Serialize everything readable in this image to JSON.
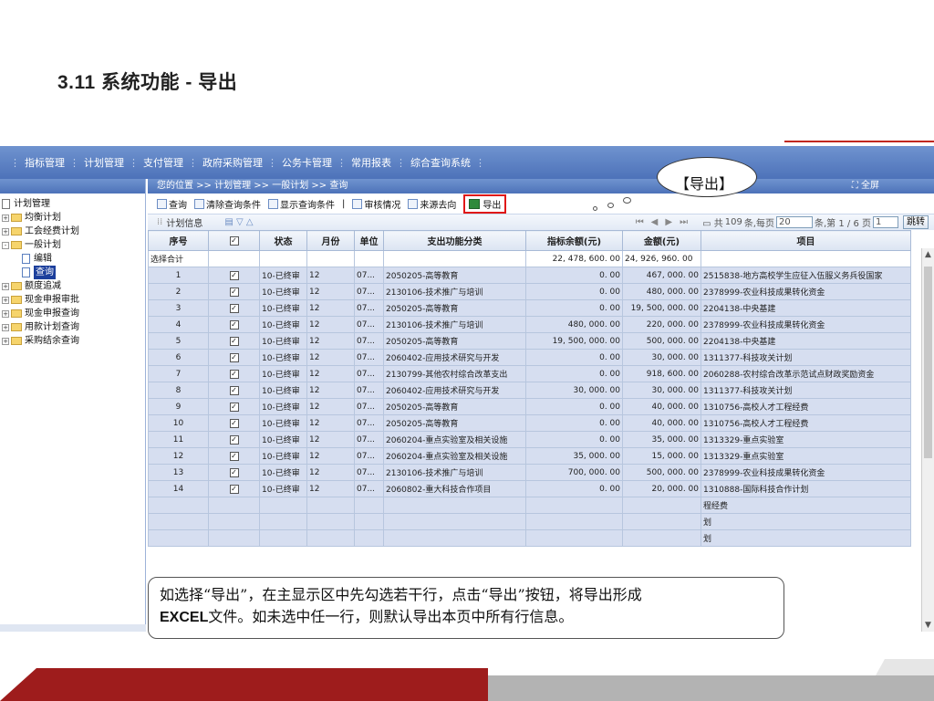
{
  "slide": {
    "title": "3.11  系统功能 - 导出"
  },
  "menubar": {
    "items": [
      "指标管理",
      "计划管理",
      "支付管理",
      "政府采购管理",
      "公务卡管理",
      "常用报表",
      "综合查询系统"
    ]
  },
  "sidebar": {
    "root": "计划管理",
    "items": [
      {
        "label": "均衡计划",
        "kind": "folder",
        "exp": "+"
      },
      {
        "label": "工会经费计划",
        "kind": "folder",
        "exp": "+"
      },
      {
        "label": "一般计划",
        "kind": "folder",
        "exp": "-"
      },
      {
        "label": "编辑",
        "kind": "doc"
      },
      {
        "label": "查询",
        "kind": "doc",
        "selected": true
      },
      {
        "label": "额度追减",
        "kind": "folder",
        "exp": "+"
      },
      {
        "label": "现金申报审批",
        "kind": "folder",
        "exp": "+"
      },
      {
        "label": "现金申报查询",
        "kind": "folder",
        "exp": "+"
      },
      {
        "label": "用款计划查询",
        "kind": "folder",
        "exp": "+"
      },
      {
        "label": "采购结余查询",
        "kind": "folder",
        "exp": "+"
      }
    ]
  },
  "breadcrumb": "您的位置 >> 计划管理 >> 一般计划 >> 查询",
  "fullscreen": "全屏",
  "toolbar": {
    "query": "查询",
    "clear": "清除查询条件",
    "show": "显示查询条件",
    "audit": "审核情况",
    "source": "来源去向",
    "export": "导出"
  },
  "grid": {
    "title": "计划信息",
    "pager": {
      "total_prefix": "共",
      "total": "109",
      "per_page_label": "条,每页",
      "per_page": "20",
      "page_label": "条,第 1 / 6 页",
      "page": "1",
      "go": "跳转"
    },
    "headers": [
      "序号",
      "",
      "状态",
      "月份",
      "单位",
      "支出功能分类",
      "指标余额(元)",
      "金额(元)",
      "项目"
    ],
    "total_row": {
      "label": "选择合计",
      "balance": "22, 478, 600. 00",
      "amount": "24, 926, 960. 00"
    },
    "rows": [
      {
        "no": "1",
        "status": "10-已终审",
        "month": "12",
        "unit": "07...",
        "cls": "2050205-高等教育",
        "bal": "0. 00",
        "amt": "467, 000. 00",
        "proj": "2515838-地方高校学生应征入伍服义务兵役国家"
      },
      {
        "no": "2",
        "status": "10-已终审",
        "month": "12",
        "unit": "07...",
        "cls": "2130106-技术推广与培训",
        "bal": "0. 00",
        "amt": "480, 000. 00",
        "proj": "2378999-农业科技成果转化资金"
      },
      {
        "no": "3",
        "status": "10-已终审",
        "month": "12",
        "unit": "07...",
        "cls": "2050205-高等教育",
        "bal": "0. 00",
        "amt": "19, 500, 000. 00",
        "proj": "2204138-中央基建"
      },
      {
        "no": "4",
        "status": "10-已终审",
        "month": "12",
        "unit": "07...",
        "cls": "2130106-技术推广与培训",
        "bal": "480, 000. 00",
        "amt": "220, 000. 00",
        "proj": "2378999-农业科技成果转化资金"
      },
      {
        "no": "5",
        "status": "10-已终审",
        "month": "12",
        "unit": "07...",
        "cls": "2050205-高等教育",
        "bal": "19, 500, 000. 00",
        "amt": "500, 000. 00",
        "proj": "2204138-中央基建"
      },
      {
        "no": "6",
        "status": "10-已终审",
        "month": "12",
        "unit": "07...",
        "cls": "2060402-应用技术研究与开发",
        "bal": "0. 00",
        "amt": "30, 000. 00",
        "proj": "1311377-科技攻关计划"
      },
      {
        "no": "7",
        "status": "10-已终审",
        "month": "12",
        "unit": "07...",
        "cls": "2130799-其他农村综合改革支出",
        "bal": "0. 00",
        "amt": "918, 600. 00",
        "proj": "2060288-农村综合改革示范试点财政奖励资金"
      },
      {
        "no": "8",
        "status": "10-已终审",
        "month": "12",
        "unit": "07...",
        "cls": "2060402-应用技术研究与开发",
        "bal": "30, 000. 00",
        "amt": "30, 000. 00",
        "proj": "1311377-科技攻关计划"
      },
      {
        "no": "9",
        "status": "10-已终审",
        "month": "12",
        "unit": "07...",
        "cls": "2050205-高等教育",
        "bal": "0. 00",
        "amt": "40, 000. 00",
        "proj": "1310756-高校人才工程经费"
      },
      {
        "no": "10",
        "status": "10-已终审",
        "month": "12",
        "unit": "07...",
        "cls": "2050205-高等教育",
        "bal": "0. 00",
        "amt": "40, 000. 00",
        "proj": "1310756-高校人才工程经费"
      },
      {
        "no": "11",
        "status": "10-已终审",
        "month": "12",
        "unit": "07...",
        "cls": "2060204-重点实验室及相关设施",
        "bal": "0. 00",
        "amt": "35, 000. 00",
        "proj": "1313329-重点实验室"
      },
      {
        "no": "12",
        "status": "10-已终审",
        "month": "12",
        "unit": "07...",
        "cls": "2060204-重点实验室及相关设施",
        "bal": "35, 000. 00",
        "amt": "15, 000. 00",
        "proj": "1313329-重点实验室"
      },
      {
        "no": "13",
        "status": "10-已终审",
        "month": "12",
        "unit": "07...",
        "cls": "2130106-技术推广与培训",
        "bal": "700, 000. 00",
        "amt": "500, 000. 00",
        "proj": "2378999-农业科技成果转化资金"
      },
      {
        "no": "14",
        "status": "10-已终审",
        "month": "12",
        "unit": "07...",
        "cls": "2060802-重大科技合作项目",
        "bal": "0. 00",
        "amt": "20, 000. 00",
        "proj": "1310888-国际科技合作计划"
      },
      {
        "no": "",
        "status": "",
        "month": "",
        "unit": "",
        "cls": "",
        "bal": "",
        "amt": "",
        "proj": "程经费"
      },
      {
        "no": "",
        "status": "",
        "month": "",
        "unit": "",
        "cls": "",
        "bal": "",
        "amt": "",
        "proj": "划"
      },
      {
        "no": "",
        "status": "",
        "month": "",
        "unit": "",
        "cls": "",
        "bal": "",
        "amt": "",
        "proj": "划"
      }
    ]
  },
  "callout_top": "【导出】",
  "callout_bottom": {
    "line1": "如选择“导出”，在主显示区中先勾选若干行，点击“导出”按钮，将导出形成",
    "line2_bold": "EXCEL",
    "line2_rest": "文件。如未选中任一行，则默认导出本页中所有行信息。"
  },
  "colors": {
    "accent_red": "#9e1c1c",
    "header_blue": "#4d72b9",
    "row_blue": "#d6def0"
  }
}
